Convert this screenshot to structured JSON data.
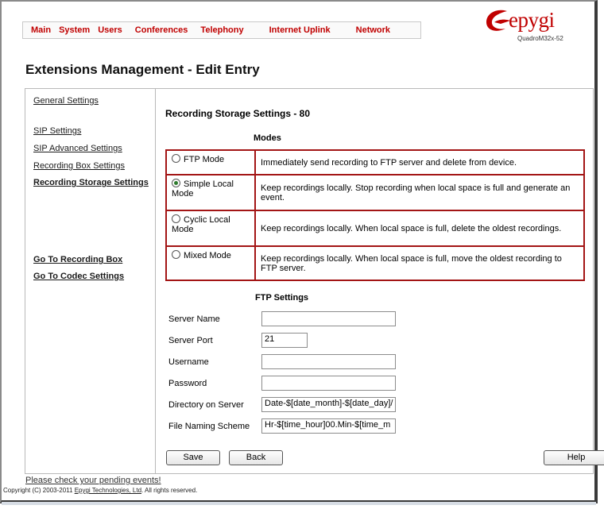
{
  "nav": {
    "items": [
      "Main",
      "System",
      "Users",
      "Conferences",
      "Telephony",
      "Internet Uplink",
      "Network"
    ]
  },
  "logo": {
    "word": "epygi",
    "model": "QuadroM32x-52",
    "brand_color": "#c00000"
  },
  "page": {
    "title": "Extensions Management - Edit Entry"
  },
  "sidebar": {
    "items": [
      "General Settings",
      "SIP Settings",
      "SIP Advanced Settings",
      "Recording Box Settings",
      "Recording Storage Settings",
      "Go To Recording Box",
      "Go To Codec Settings"
    ]
  },
  "main": {
    "section_title": "Recording Storage Settings - 80",
    "modes_heading": "Modes",
    "modes": [
      {
        "label": "FTP Mode",
        "description": "Immediately send recording to FTP server and delete from device.",
        "selected": false
      },
      {
        "label": "Simple Local Mode",
        "description": "Keep recordings locally. Stop recording when local space is full and generate an event.",
        "selected": true
      },
      {
        "label": "Cyclic Local Mode",
        "description": "Keep recordings locally. When local space is full, delete the oldest recordings.",
        "selected": false
      },
      {
        "label": "Mixed Mode",
        "description": "Keep recordings locally. When local space is full, move the oldest recording to FTP server.",
        "selected": false
      }
    ],
    "ftp_heading": "FTP Settings",
    "ftp_fields": [
      {
        "label": "Server Name",
        "value": ""
      },
      {
        "label": "Server Port",
        "value": "21"
      },
      {
        "label": "Username",
        "value": ""
      },
      {
        "label": "Password",
        "value": ""
      },
      {
        "label": "Directory on Server",
        "value": "Date-$[date_month]-$[date_day]/"
      },
      {
        "label": "File Naming Scheme",
        "value": "Hr-$[time_hour]00.Min-$[time_m"
      }
    ],
    "buttons": {
      "save": "Save",
      "back": "Back",
      "help": "Help"
    }
  },
  "footer": {
    "pending": "Please check your pending events!",
    "copyright_prefix": "Copyright (C) 2003-2011 ",
    "copyright_link": "Epygi Technologies, Ltd",
    "copyright_suffix": ". All rights reserved."
  },
  "colors": {
    "accent": "#c00000",
    "table_border": "#a31515"
  }
}
